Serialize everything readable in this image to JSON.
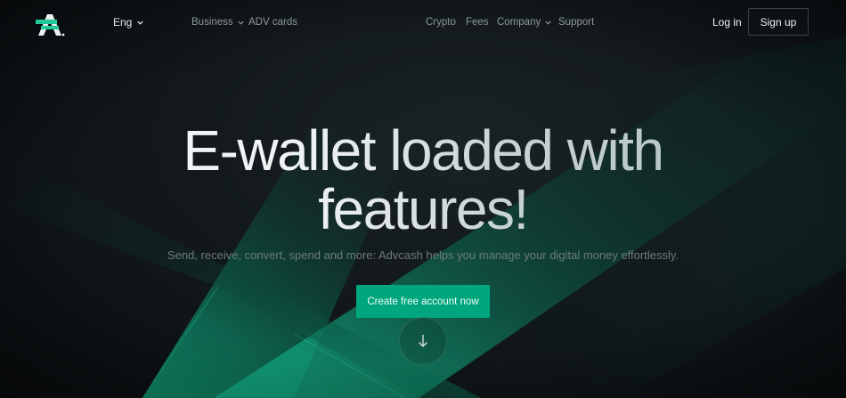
{
  "header": {
    "language": "Eng",
    "nav_left": [
      {
        "label": "Business",
        "has_dropdown": true
      },
      {
        "label": "ADV cards",
        "has_dropdown": false
      }
    ],
    "nav_right": [
      {
        "label": "Crypto",
        "has_dropdown": false
      },
      {
        "label": "Fees",
        "has_dropdown": false
      },
      {
        "label": "Company",
        "has_dropdown": true
      },
      {
        "label": "Support",
        "has_dropdown": false
      }
    ],
    "login_label": "Log in",
    "signup_label": "Sign up"
  },
  "hero": {
    "title_line1": "E-wallet loaded with",
    "title_line2": "features!",
    "subtitle": "Send, receive, convert, spend and more: Advcash helps you manage your digital money effortlessly.",
    "cta_label": "Create free account now"
  },
  "icons": {
    "logo": "advcash-logo-icon",
    "language_chevron": "chevron-down-icon",
    "scroll": "arrow-down-icon"
  },
  "colors": {
    "background": "#0e1316",
    "accent": "#00a77e",
    "accent_light": "#1fc99a",
    "nav_text": "#8c989c",
    "subtitle_text": "#6b7a7e"
  }
}
